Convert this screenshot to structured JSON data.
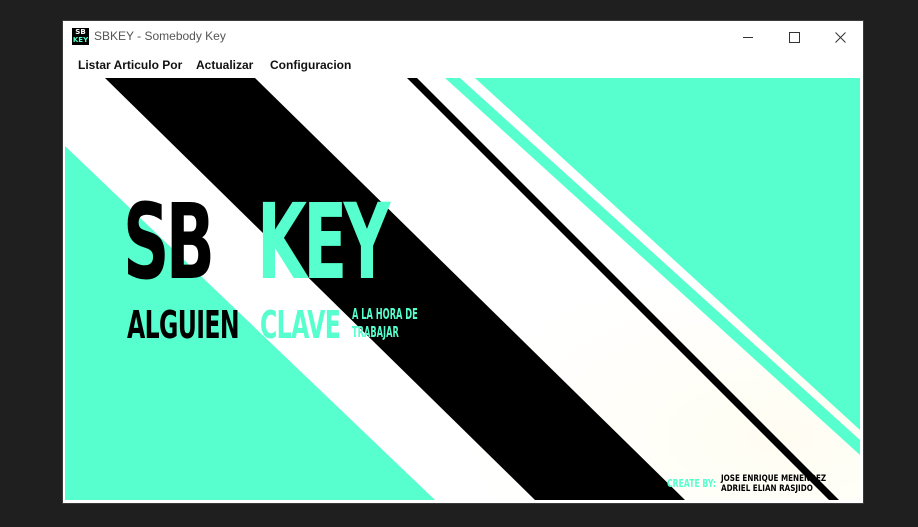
{
  "window": {
    "title": "SBKEY - Somebody Key",
    "logo_line1": "SB",
    "logo_line2": "KEY",
    "controls": {
      "minimize_icon": "minimize-icon",
      "maximize_icon": "maximize-icon",
      "close_icon": "close-icon"
    }
  },
  "menu": [
    {
      "label": "Listar Articulo Por"
    },
    {
      "label": "Actualizar"
    },
    {
      "label": "Configuracion"
    }
  ],
  "banner": {
    "wordmark_black": "SB",
    "wordmark_accent": "KEY",
    "sub_black": "ALGUIEN",
    "sub_accent": "CLAVE",
    "tagline_1": "A LA HORA DE",
    "tagline_2": "TRABAJAR",
    "credit_label": "CREATE BY:",
    "credit_name_1": "JOSE ENRIQUE MENENDEZ",
    "credit_name_2": "ADRIEL ELIAN RASJIDO"
  },
  "colors": {
    "accent": "#56ffcd",
    "black": "#000000",
    "white": "#ffffff",
    "desktop": "#1f1f1f"
  }
}
